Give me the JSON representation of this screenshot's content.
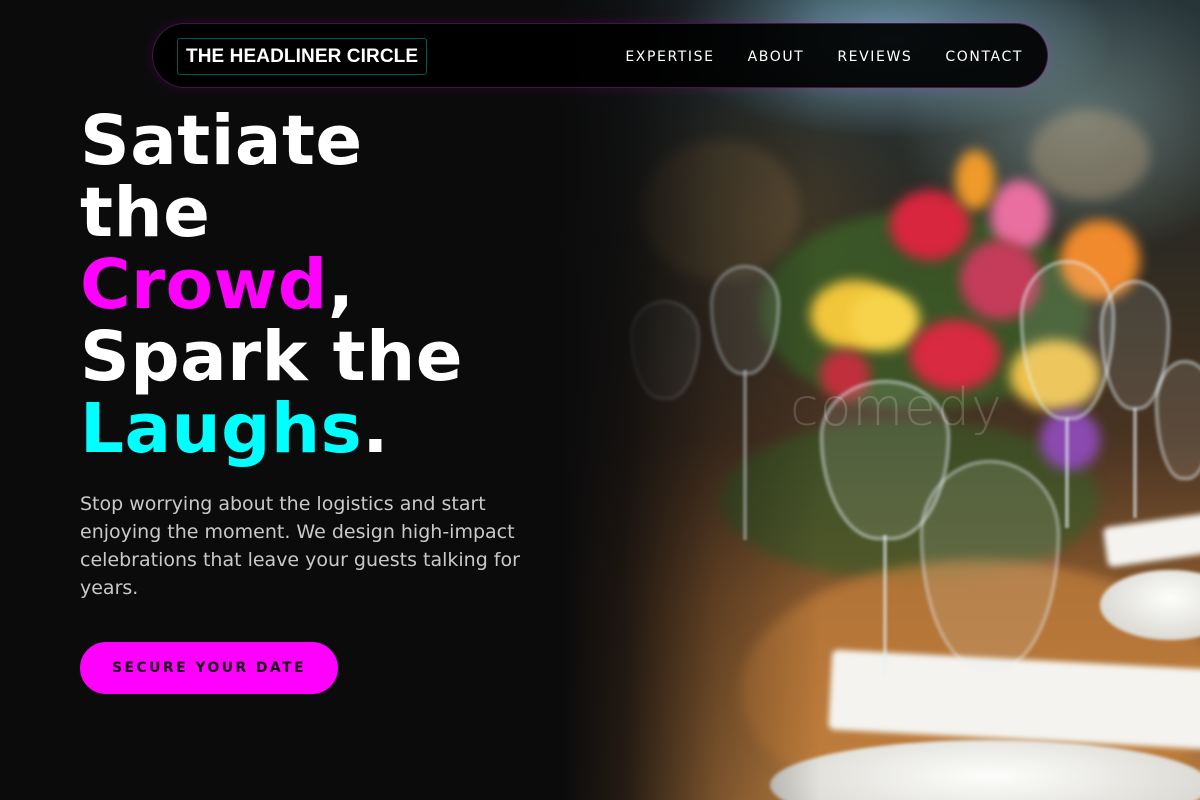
{
  "nav": {
    "logo": "THE HEADLINER CIRCLE",
    "links": [
      "EXPERTISE",
      "ABOUT",
      "REVIEWS",
      "CONTACT"
    ]
  },
  "hero": {
    "line1": "Satiate",
    "line2": "the",
    "line3_highlight": "Crowd",
    "line3_suffix": ",",
    "line4": "Spark the",
    "line5_highlight": "Laughs",
    "line5_suffix": ".",
    "subtext": "Stop worrying about the logistics and start enjoying the moment. We design high-impact celebrations that leave your guests talking for years.",
    "cta": "SECURE YOUR DATE",
    "image_watermark": "comedy"
  },
  "colors": {
    "background": "#0b0b0c",
    "accent_magenta": "#ff00ff",
    "accent_cyan": "#00ffff",
    "text_primary": "#ffffff",
    "text_muted": "#c9c9cc"
  }
}
